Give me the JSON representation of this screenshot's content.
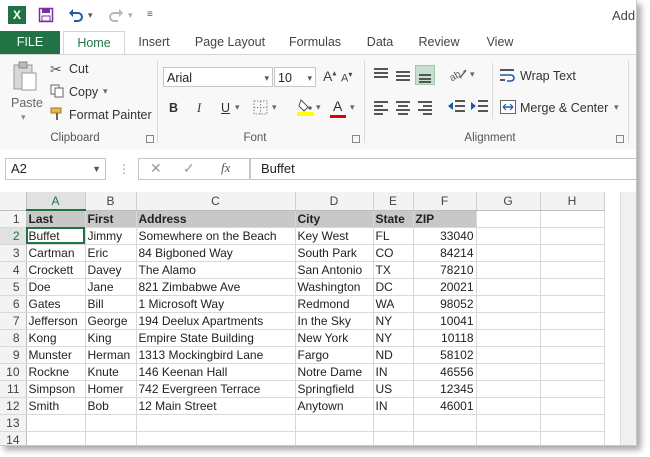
{
  "app": {
    "icon_label": "X",
    "title": "Add"
  },
  "tabs": [
    "FILE",
    "Home",
    "Insert",
    "Page Layout",
    "Formulas",
    "Data",
    "Review",
    "View"
  ],
  "clipboard": {
    "paste": "Paste",
    "cut": "Cut",
    "copy": "Copy",
    "format_painter": "Format Painter",
    "group": "Clipboard"
  },
  "font": {
    "name": "Arial",
    "size": "10",
    "bold": "B",
    "italic": "I",
    "underline": "U",
    "font_color": "A",
    "group": "Font"
  },
  "alignment": {
    "wrap_text": "Wrap Text",
    "merge_center": "Merge & Center",
    "group": "Alignment"
  },
  "formula_bar": {
    "name_box": "A2",
    "fx": "fx",
    "content": "Buffet"
  },
  "sheet": {
    "columns": [
      "A",
      "B",
      "C",
      "D",
      "E",
      "F",
      "G",
      "H"
    ],
    "row_numbers": [
      "1",
      "2",
      "3",
      "4",
      "5",
      "6",
      "7",
      "8",
      "9",
      "10",
      "11",
      "12",
      "13",
      "14"
    ],
    "header": [
      "Last",
      "First",
      "Address",
      "City",
      "State",
      "ZIP"
    ],
    "rows": [
      [
        "Buffet",
        "Jimmy",
        "Somewhere on the Beach",
        "Key West",
        "FL",
        "33040"
      ],
      [
        "Cartman",
        "Eric",
        "84 Bigboned Way",
        "South Park",
        "CO",
        "84214"
      ],
      [
        "Crockett",
        "Davey",
        "The Alamo",
        "San Antonio",
        "TX",
        "78210"
      ],
      [
        "Doe",
        "Jane",
        "821 Zimbabwe Ave",
        "Washington",
        "DC",
        "20021"
      ],
      [
        "Gates",
        "Bill",
        "1 Microsoft Way",
        "Redmond",
        "WA",
        "98052"
      ],
      [
        "Jefferson",
        "George",
        "194 Deelux Apartments",
        "In the Sky",
        "NY",
        "10041"
      ],
      [
        "Kong",
        "King",
        "Empire State Building",
        "New York",
        "NY",
        "10118"
      ],
      [
        "Munster",
        "Herman",
        "1313 Mockingbird Lane",
        "Fargo",
        "ND",
        "58102"
      ],
      [
        "Rockne",
        "Knute",
        "146 Keenan Hall",
        "Notre Dame",
        "IN",
        "46556"
      ],
      [
        "Simpson",
        "Homer",
        "742 Evergreen Terrace",
        "Springfield",
        "US",
        "12345"
      ],
      [
        "Smith",
        "Bob",
        "12 Main Street",
        "Anytown",
        "IN",
        "46001"
      ]
    ],
    "active_cell": "A2"
  },
  "colors": {
    "accent": "#217346",
    "header_fill": "#c8c8c8"
  }
}
